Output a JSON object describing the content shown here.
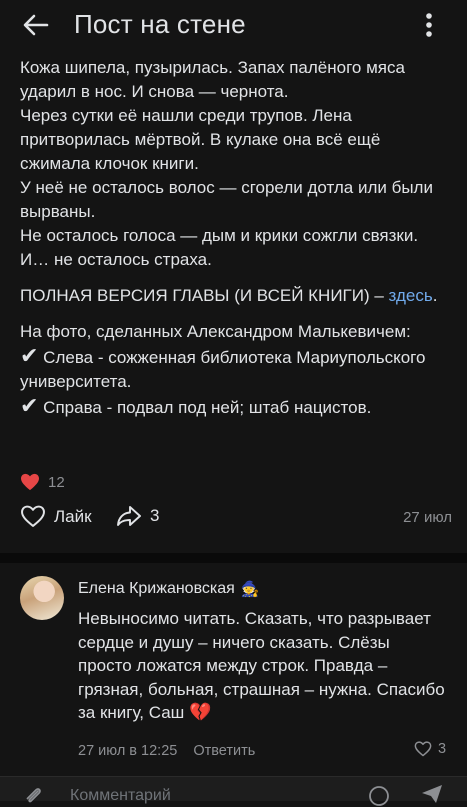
{
  "header": {
    "title": "Пост на стене"
  },
  "post": {
    "paragraphs": [
      "Кожа шипела, пузырилась. Запах палёного мяса ударил в нос. И снова — чернота.",
      "Через сутки её нашли среди трупов. Лена притворилась мёртвой. В кулаке она всё ещё сжимала клочок книги.",
      "У неё не осталось волос — сгорели дотла или были вырваны.",
      "Не осталось голоса — дым и крики сожгли связки.",
      "И… не осталось страха."
    ],
    "full_version_text": "ПОЛНАЯ ВЕРСИЯ ГЛАВЫ (И ВСЕЙ КНИГИ) –",
    "full_version_link": "здесь",
    "full_version_end": ".",
    "photo_intro": "На фото, сделанных Александром Малькевичем:",
    "photo_items": [
      {
        "mark": "✔",
        "text": "Слева - сожженная библиотека Мариупольского университета."
      },
      {
        "mark": "✔",
        "text": "Справа - подвал под ней; штаб нацистов."
      }
    ],
    "reactions_count": "12",
    "like_label": "Лайк",
    "share_count": "3",
    "date": "27 июл"
  },
  "comment": {
    "author": "Елена Крижановская",
    "author_badge": "🧙",
    "text": "Невыносимо читать. Сказать, что разрывает сердце и душу – ничего сказать. Слёзы просто ложатся между строк. Правда – грязная, больная, страшная – нужна. Спасибо за книгу, Саш",
    "emoji": "💔",
    "time": "27 июл в 12:25",
    "reply_label": "Ответить",
    "likes": "3"
  },
  "composer": {
    "placeholder": "Комментарий"
  },
  "colors": {
    "background": "#141414",
    "text": "#e1e3e6",
    "secondary": "#8d8f93",
    "link": "#71aaeb",
    "heart": "#e64646"
  }
}
